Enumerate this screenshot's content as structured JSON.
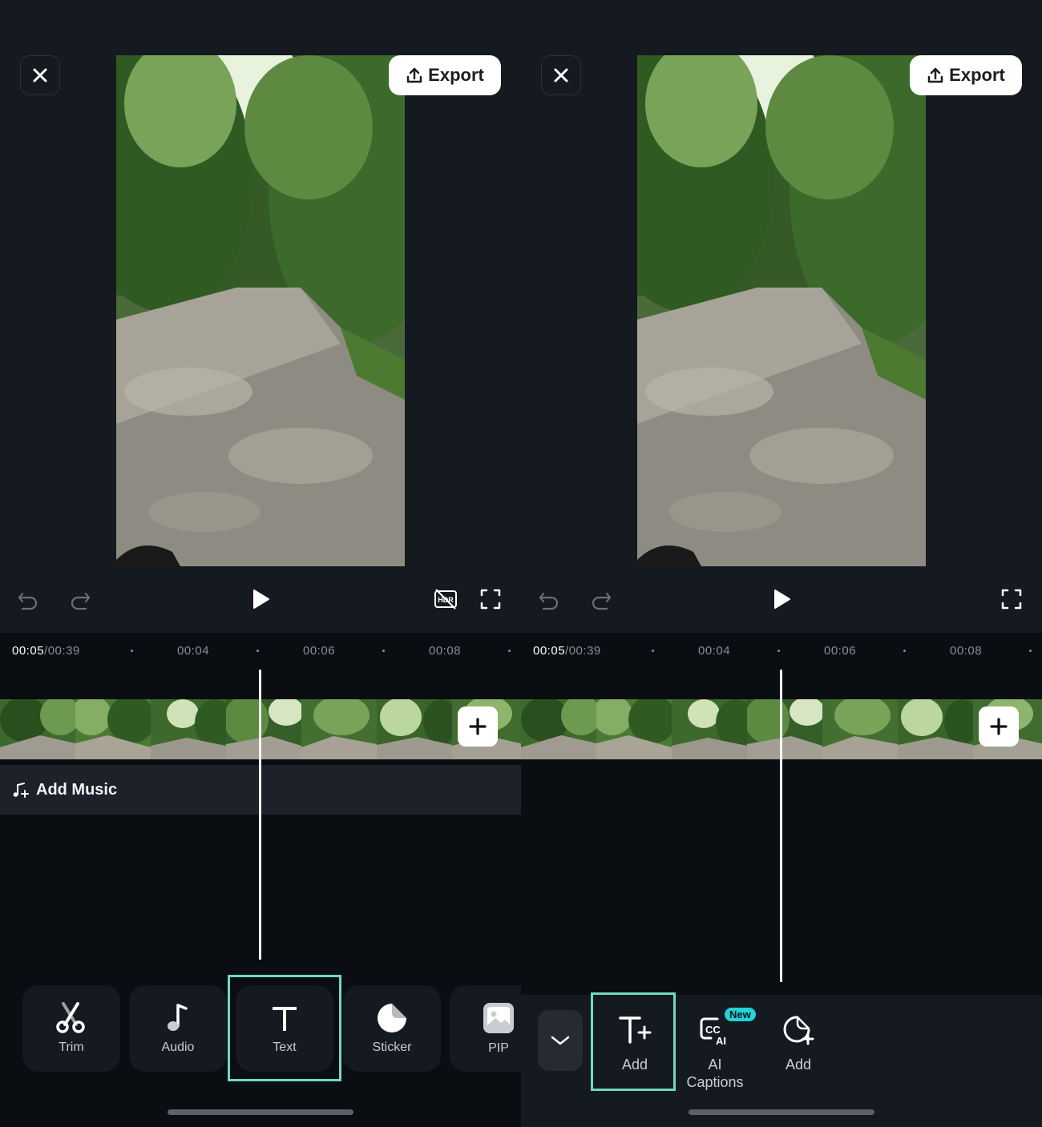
{
  "left": {
    "export_label": "Export",
    "time_current": "00:05",
    "time_total": "/00:39",
    "ticks": [
      "00:04",
      "00:06",
      "00:08"
    ],
    "add_music_label": "Add Music",
    "tools": [
      {
        "label": "Trim",
        "icon": "scissors-icon"
      },
      {
        "label": "Audio",
        "icon": "music-note-icon"
      },
      {
        "label": "Text",
        "icon": "text-icon"
      },
      {
        "label": "Sticker",
        "icon": "sticker-icon"
      },
      {
        "label": "PIP",
        "icon": "pip-icon"
      }
    ],
    "highlighted_tool": "Text"
  },
  "right": {
    "export_label": "Export",
    "time_current": "00:05",
    "time_total": "/00:39",
    "ticks": [
      "00:04",
      "00:06",
      "00:08"
    ],
    "sub_tools": [
      {
        "label": "Add",
        "icon": "add-text-icon"
      },
      {
        "label": "AI\nCaptions",
        "icon": "ai-captions-icon",
        "badge": "New"
      },
      {
        "label": "Add",
        "icon": "add-sticker-icon"
      }
    ],
    "highlighted_tool": "Add"
  },
  "colors": {
    "highlight": "#6fd9c4",
    "badge": "#22d3d8",
    "background": "#0a0d11",
    "panel": "#151a21"
  }
}
